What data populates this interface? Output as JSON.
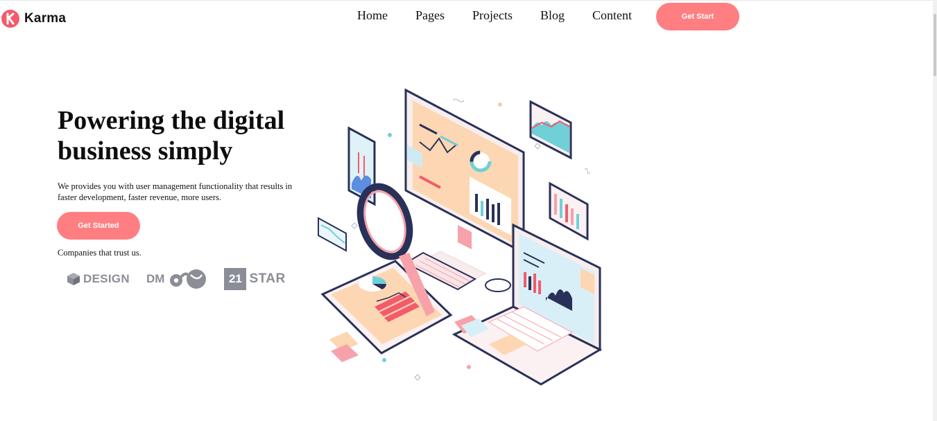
{
  "brand": {
    "name": "Karma",
    "logo_letter": "K",
    "accent": "#f35b6b"
  },
  "nav": {
    "items": [
      "Home",
      "Pages",
      "Projects",
      "Blog",
      "Content"
    ]
  },
  "header": {
    "cta_label": "Get Start"
  },
  "hero": {
    "title": "Powering the digital business simply",
    "description": "We provides you with user management functionality that results in faster development, faster revenue, more users.",
    "cta_label": "Get Started",
    "trust_label": "Companies that trust us."
  },
  "partners": {
    "design": "DESIGN",
    "dm": "DM",
    "num": "21",
    "star": "STAR"
  },
  "colors": {
    "button": "#ff7e82",
    "partner_gray": "#8b8e96",
    "navy": "#27305a",
    "peach": "#fdd9b5",
    "teal": "#6fd0d8"
  }
}
